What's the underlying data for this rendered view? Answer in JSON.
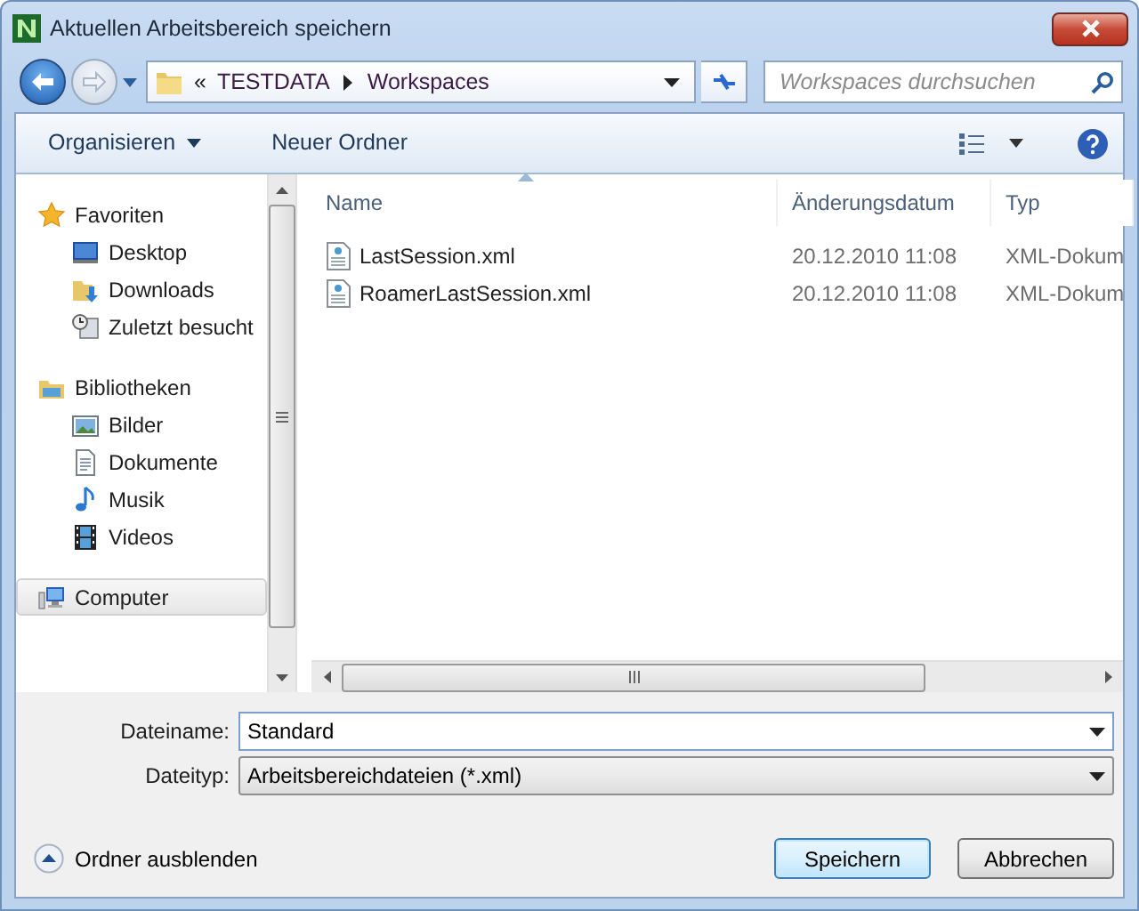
{
  "window": {
    "title": "Aktuellen Arbeitsbereich speichern"
  },
  "address_bar": {
    "overflow": "«",
    "path": [
      "TESTDATA",
      "Workspaces"
    ]
  },
  "search": {
    "placeholder": "Workspaces durchsuchen"
  },
  "toolbar": {
    "organize": "Organisieren",
    "new_folder": "Neuer Ordner"
  },
  "navigation": [
    {
      "label": "Favoriten",
      "selected": false,
      "children": [
        {
          "label": "Desktop",
          "selected": false
        },
        {
          "label": "Downloads",
          "selected": false
        },
        {
          "label": "Zuletzt besucht",
          "selected": false
        }
      ]
    },
    {
      "label": "Bibliotheken",
      "selected": false,
      "children": [
        {
          "label": "Bilder",
          "selected": false
        },
        {
          "label": "Dokumente",
          "selected": false
        },
        {
          "label": "Musik",
          "selected": false
        },
        {
          "label": "Videos",
          "selected": false
        }
      ]
    },
    {
      "label": "Computer",
      "selected": true
    }
  ],
  "columns": [
    {
      "label": "Name",
      "sorted": true
    },
    {
      "label": "Änderungsdatum",
      "sorted": false
    },
    {
      "label": "Typ",
      "sorted": false
    }
  ],
  "files": [
    {
      "name": "LastSession.xml",
      "modified": "20.12.2010 11:08",
      "type": "XML-Dokum"
    },
    {
      "name": "RoamerLastSession.xml",
      "modified": "20.12.2010 11:08",
      "type": "XML-Dokum"
    }
  ],
  "file_name": {
    "label": "Dateiname:",
    "value": "Standard"
  },
  "file_type": {
    "label": "Dateityp:",
    "value": "Arbeitsbereichdateien (*.xml)"
  },
  "hide_folders": "Ordner ausblenden",
  "buttons": [
    {
      "label": "Speichern",
      "default": true
    },
    {
      "label": "Abbrechen",
      "default": false
    }
  ]
}
